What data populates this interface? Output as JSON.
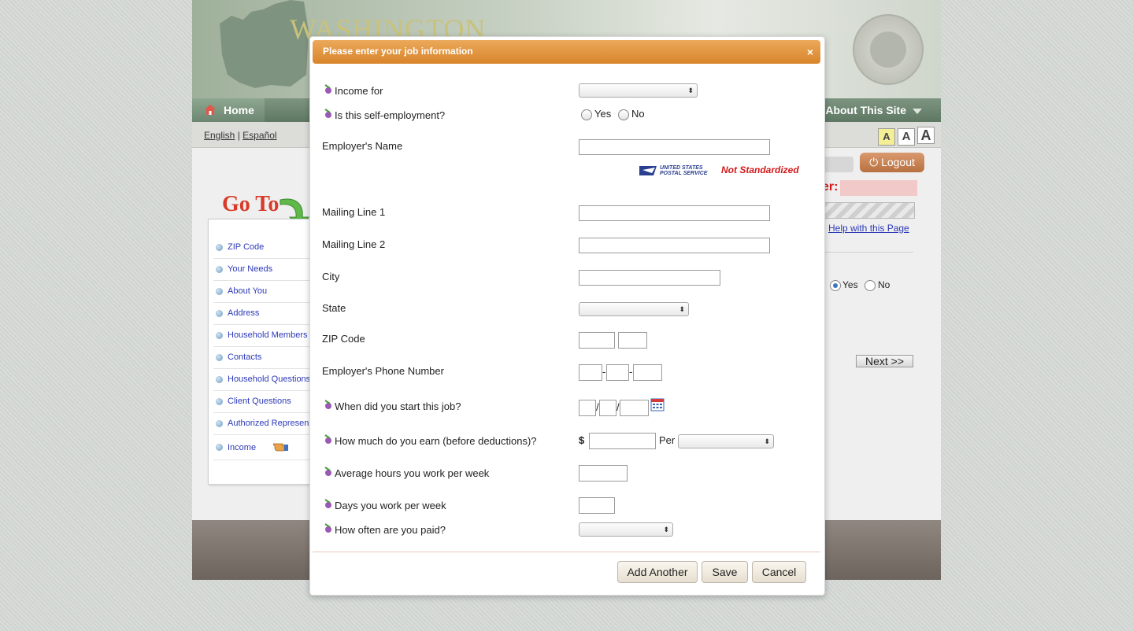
{
  "banner": {
    "title": "WASHINGTON"
  },
  "nav": {
    "home": "Home",
    "about": "About This Site"
  },
  "lang": {
    "english": "English",
    "sep": "|",
    "espanol": "Español"
  },
  "font_sizes": [
    "A",
    "A",
    "A"
  ],
  "goto": "Go To",
  "sidebar": {
    "items": [
      {
        "label": "ZIP Code"
      },
      {
        "label": "Your Needs"
      },
      {
        "label": "About You"
      },
      {
        "label": "Address"
      },
      {
        "label": "Household Members"
      },
      {
        "label": "Contacts"
      },
      {
        "label": "Household Questions"
      },
      {
        "label": "Client Questions"
      },
      {
        "label": "Authorized Represen"
      },
      {
        "label": "Income"
      }
    ]
  },
  "right_panel": {
    "logout": "Logout",
    "er_label": "er:",
    "help_link": "Help with this Page",
    "yes": "Yes",
    "no": "No",
    "next": "Next >>"
  },
  "modal": {
    "title": "Please enter your job information",
    "close": "×",
    "fields": {
      "income_for": "Income for",
      "self_employment": "Is this self-employment?",
      "yes": "Yes",
      "no": "No",
      "employer_name": "Employer's Name",
      "usps_line1": "UNITED STATES",
      "usps_line2": "POSTAL SERVICE",
      "not_standardized": "Not Standardized",
      "mailing1": "Mailing Line 1",
      "mailing2": "Mailing Line 2",
      "city": "City",
      "state": "State",
      "zip": "ZIP Code",
      "phone": "Employer's Phone Number",
      "start_job": "When did you start this job?",
      "earn": "How much do you earn (before deductions)?",
      "dollar": "$",
      "per": "Per",
      "avg_hours": "Average hours you work per week",
      "days": "Days you work per week",
      "how_often": "How often are you paid?"
    },
    "buttons": {
      "add_another": "Add Another",
      "save": "Save",
      "cancel": "Cancel"
    }
  }
}
